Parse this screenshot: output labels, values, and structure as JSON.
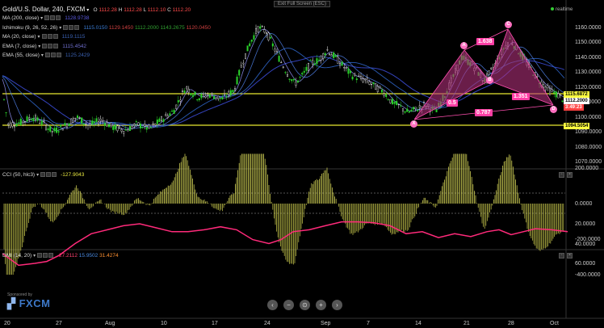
{
  "header": {
    "symbol": "Gold/U.S. Dollar, 240, FXCM",
    "o_label": "O",
    "o": "1112.28",
    "h_label": "H",
    "h": "1112.28",
    "l_label": "L",
    "l": "1112.10",
    "c_label": "C",
    "c": "1112.20",
    "exit_fullscreen": "Exit Full Screen (ESC)",
    "realtime": "realtime"
  },
  "indicators": [
    {
      "name": "MA (200, close)",
      "value": "1128.9738",
      "color": "#5a5ae0"
    },
    {
      "name": "Ichimoku (9, 26, 52, 26)",
      "value": "1115.0150",
      "extra": [
        "1129.1450",
        "1112.2000",
        "1143.2675",
        "1120.0450"
      ],
      "color": "#3a7ad0"
    },
    {
      "name": "MA (20, close)",
      "value": "1119.1115",
      "color": "#3a60b0"
    },
    {
      "name": "EMA (7, close)",
      "value": "1115.4542",
      "color": "#7070d0"
    },
    {
      "name": "EMA (55, close)",
      "value": "1125.2429",
      "color": "#3a60b0"
    }
  ],
  "ichimoku_colors": [
    "#d04040",
    "#30a030",
    "#30a030",
    "#d04040"
  ],
  "price_axis": [
    "1160.0000",
    "1150.0000",
    "1140.0000",
    "1130.0000",
    "1120.0000",
    "1110.0000",
    "1100.0000",
    "1090.0000",
    "1080.0000",
    "1070.0000"
  ],
  "price_tags": [
    {
      "label": "1115.6872",
      "bg": "#ffff40"
    },
    {
      "label": "1112.2000",
      "bg": "#ffffff"
    },
    {
      "label": "3:49:23",
      "bg": "#ff4040"
    },
    {
      "label": "1094.5054",
      "bg": "#ffff40"
    }
  ],
  "pattern": {
    "ratios": [
      "1.638",
      "0.5",
      "1.351",
      "0.787"
    ],
    "points": [
      "X",
      "A",
      "B",
      "C",
      "D"
    ]
  },
  "cci": {
    "title": "CCI (50, hlc3)",
    "value": "-127.9043",
    "axis": [
      "200.0000",
      "0.0000",
      "-200.0000",
      "-400.0000"
    ]
  },
  "dmi": {
    "title": "DMI (14, 20)",
    "values": [
      "27.2112",
      "15.9502",
      "31.4274"
    ],
    "axis": [
      "60.0000",
      "40.0000",
      "20.0000"
    ]
  },
  "time_axis": [
    "20",
    "27",
    "Aug",
    "10",
    "17",
    "24",
    "Sep",
    "7",
    "14",
    "21",
    "28",
    "Oct"
  ],
  "sponsor": {
    "line1": "Sponsored by",
    "line2": "FXCM"
  },
  "nav_buttons": [
    "‹",
    "−",
    "⊙",
    "+",
    "›"
  ]
}
